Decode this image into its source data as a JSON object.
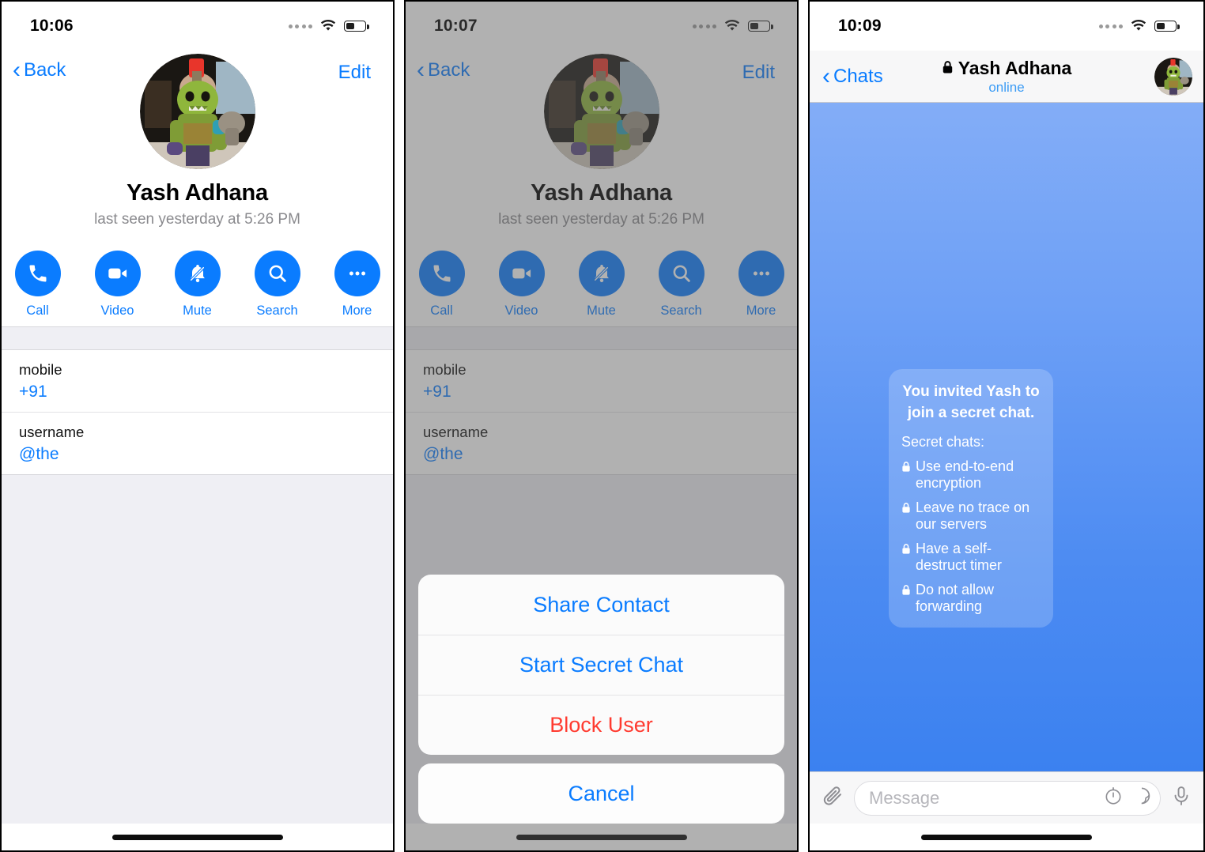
{
  "app": "Telegram iOS — Secret Chat flow",
  "panels": [
    {
      "id": "profile",
      "statusbar": {
        "time": "10:06",
        "signal_icon": "signal-dots-icon",
        "wifi_icon": "wifi-icon",
        "battery_icon": "battery-icon",
        "battery_level": 40
      },
      "nav": {
        "back_label": "Back",
        "back_icon": "chevron-left-icon",
        "edit_label": "Edit"
      },
      "profile": {
        "avatar_icon": "contact-avatar",
        "name": "Yash Adhana",
        "status": "last seen yesterday at 5:26 PM"
      },
      "actions": [
        {
          "label": "Call",
          "icon": "phone-icon"
        },
        {
          "label": "Video",
          "icon": "video-camera-icon"
        },
        {
          "label": "Mute",
          "icon": "bell-slash-icon"
        },
        {
          "label": "Search",
          "icon": "search-icon"
        },
        {
          "label": "More",
          "icon": "ellipsis-icon"
        }
      ],
      "info": [
        {
          "key": "mobile",
          "value": "+91"
        },
        {
          "key": "username",
          "value": "@the"
        }
      ]
    },
    {
      "id": "action-sheet",
      "statusbar": {
        "time": "10:07",
        "signal_icon": "signal-dots-icon",
        "wifi_icon": "wifi-icon",
        "battery_icon": "battery-icon",
        "battery_level": 40
      },
      "nav": {
        "back_label": "Back",
        "back_icon": "chevron-left-icon",
        "edit_label": "Edit"
      },
      "profile": {
        "avatar_icon": "contact-avatar",
        "name": "Yash Adhana",
        "status": "last seen yesterday at 5:26 PM"
      },
      "actions": [
        {
          "label": "Call",
          "icon": "phone-icon"
        },
        {
          "label": "Video",
          "icon": "video-camera-icon"
        },
        {
          "label": "Mute",
          "icon": "bell-slash-icon"
        },
        {
          "label": "Search",
          "icon": "search-icon"
        },
        {
          "label": "More",
          "icon": "ellipsis-icon"
        }
      ],
      "info": [
        {
          "key": "mobile",
          "value": "+91"
        },
        {
          "key": "username",
          "value": "@the"
        }
      ],
      "sheet": {
        "items": [
          {
            "label": "Share Contact",
            "style": "default"
          },
          {
            "label": "Start Secret Chat",
            "style": "default"
          },
          {
            "label": "Block User",
            "style": "destructive"
          }
        ],
        "cancel_label": "Cancel"
      }
    },
    {
      "id": "secret-chat",
      "statusbar": {
        "time": "10:09",
        "signal_icon": "signal-dots-icon",
        "wifi_icon": "wifi-icon",
        "battery_icon": "battery-icon",
        "battery_level": 40
      },
      "nav": {
        "back_label": "Chats",
        "back_icon": "chevron-left-icon",
        "lock_icon": "lock-icon",
        "title": "Yash Adhana",
        "subtitle": "online",
        "avatar_icon": "contact-avatar"
      },
      "bubble": {
        "title": "You invited Yash to join a secret chat.",
        "lead": "Secret chats:",
        "items": [
          {
            "icon": "lock-icon",
            "text": "Use end-to-end encryption"
          },
          {
            "icon": "lock-icon",
            "text": "Leave no trace on our servers"
          },
          {
            "icon": "lock-icon",
            "text": "Have a self-destruct timer"
          },
          {
            "icon": "lock-icon",
            "text": "Do not allow forwarding"
          }
        ]
      },
      "input": {
        "attach_icon": "paperclip-icon",
        "placeholder": "Message",
        "timer_icon": "self-destruct-timer-icon",
        "sticker_icon": "sticker-icon",
        "mic_icon": "microphone-icon"
      }
    }
  ],
  "colors": {
    "accent_blue": "#0a7cff",
    "destructive_red": "#ff3b30",
    "chat_gradient_top": "#83adf7",
    "chat_gradient_bottom": "#3b81f0",
    "secondary_text": "#8a8a8e",
    "separator_bg": "#efeff4"
  }
}
